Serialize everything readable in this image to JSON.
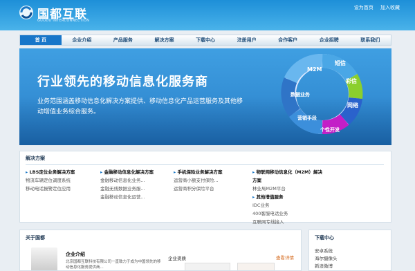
{
  "header": {
    "logo_cn": "国都互联",
    "logo_en": "GUODU INTERCONNECTION",
    "links": [
      "设为首页",
      "加入收藏"
    ]
  },
  "nav": [
    "首 页",
    "企业介绍",
    "产品服务",
    "解决方案",
    "下载中心",
    "注册用户",
    "合作客户",
    "企业招聘",
    "联系我们"
  ],
  "banner": {
    "headline": "行业领先的移动信息化服务商",
    "subtext": "业务范围涵盖移动信息化解决方案提供、移动信息化产品运营服务及其他移动增值业务综合服务。",
    "ring_labels": [
      "M2M",
      "短信",
      "彩信",
      "网络",
      "个性开发",
      "营销手段",
      "数据业务"
    ]
  },
  "solutions": {
    "title": "解决方案",
    "columns": [
      {
        "title": "LBS定位业务解决方案",
        "items": [
          "物流车辆定位调度系统",
          "移动电话报警定位应用"
        ]
      },
      {
        "title": "金融移动信息化解决方案",
        "items": [
          "金融移动信息化业务...",
          "金融无线数据业务服...",
          "金融移动信息化运营..."
        ]
      },
      {
        "title": "手机保险业务解决方案",
        "items": [
          "运营商小额支付保险...",
          "运营商积分保险平台"
        ]
      },
      {
        "title": "物联网移动信息化（M2M）解决方案",
        "items": [
          "林业局M2M平台",
          "IDC业务",
          "400客服电话业务",
          "互联网专线接入"
        ],
        "extra_title": "其他增值服务"
      }
    ]
  },
  "about": {
    "title": "关于国都",
    "profile_label": "企业介绍",
    "profile_text": "北京国都互联科技有限公司一直致力于成为中国领先的移动信息化服务提供商...",
    "resources": "企业资质",
    "more": "查看详情"
  },
  "download": {
    "title": "下载中心",
    "items": [
      "安卓系统",
      "海尔摄像头",
      "新浪微博"
    ]
  },
  "colors": {
    "primary": "#1b78c6",
    "accent": "#d46719"
  }
}
